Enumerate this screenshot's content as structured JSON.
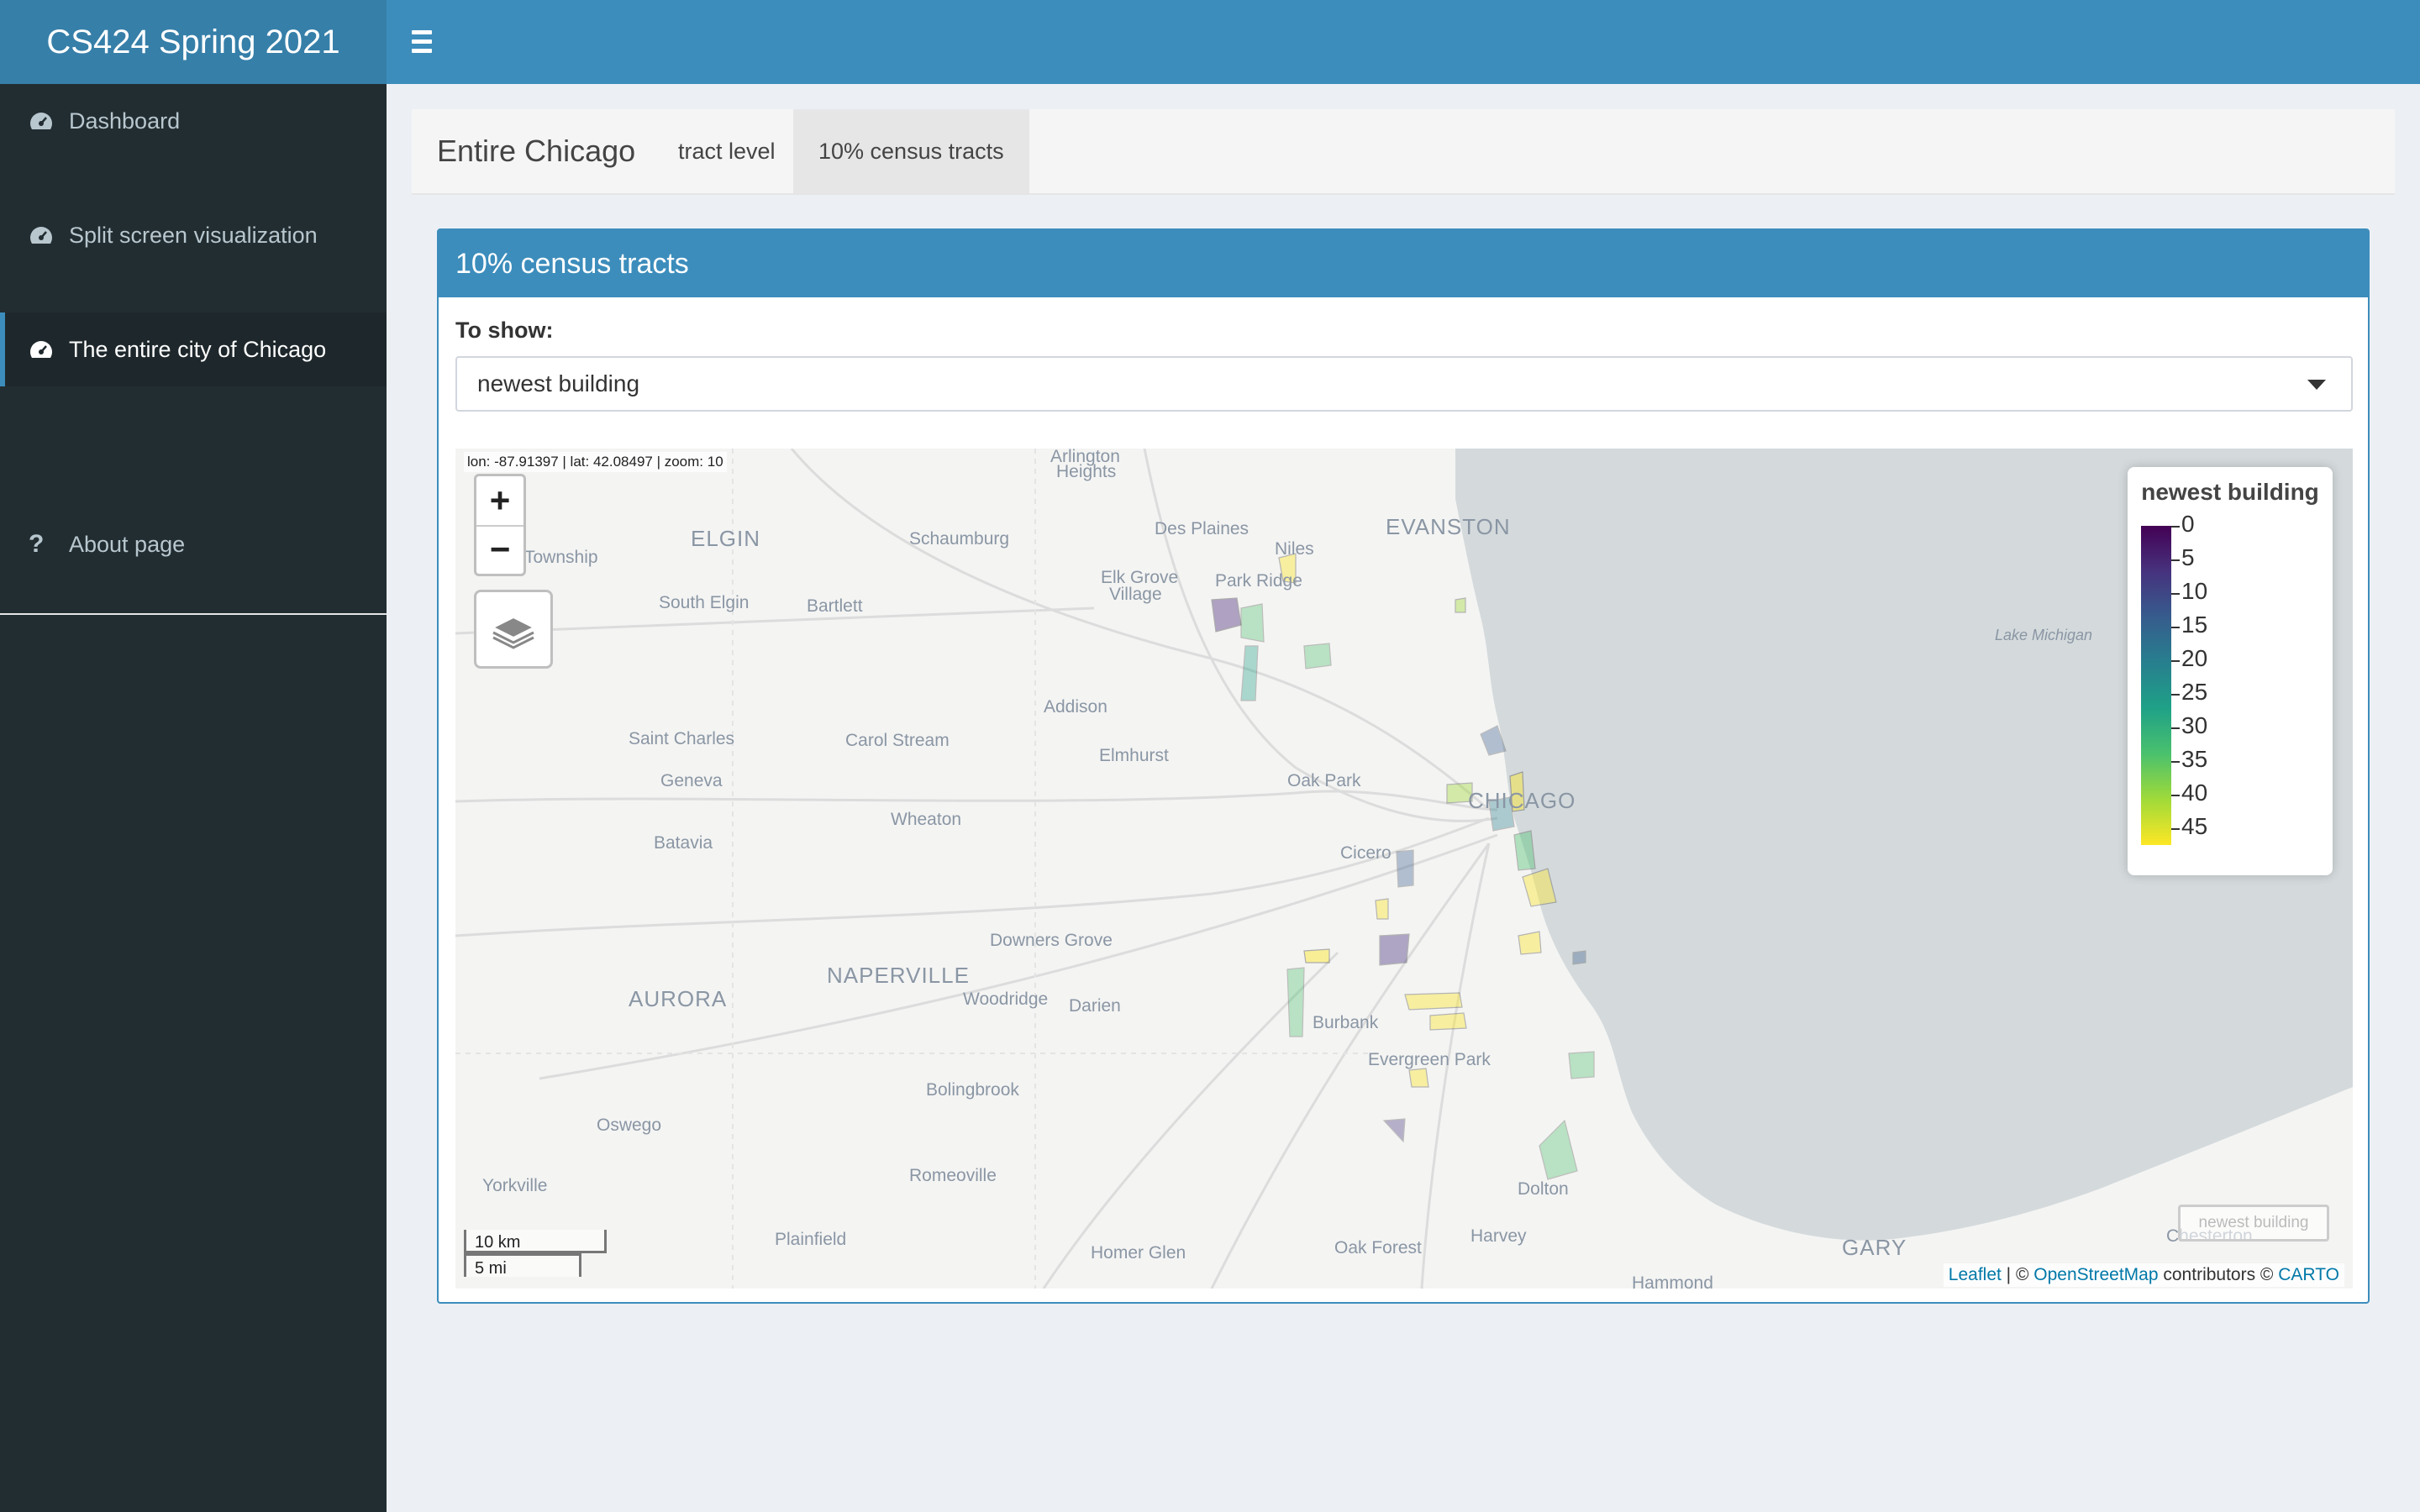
{
  "app": {
    "title": "CS424 Spring 2021"
  },
  "sidebar": {
    "items": [
      {
        "label": "Dashboard",
        "icon": "dashboard-icon"
      },
      {
        "label": "Split screen visualization",
        "icon": "dashboard-icon"
      },
      {
        "label": "The entire city of Chicago",
        "icon": "dashboard-icon",
        "active": true
      },
      {
        "label": "About page",
        "icon": "question-icon"
      }
    ]
  },
  "tabbox": {
    "title": "Entire Chicago",
    "tabs": [
      {
        "label": "tract level"
      },
      {
        "label": "10% census tracts",
        "active": true
      }
    ]
  },
  "panel": {
    "title": "10% census tracts",
    "select_label": "To show:",
    "selected": "newest building"
  },
  "map": {
    "mouse_position": "lon: -87.91397 | lat: 42.08497 | zoom: 10",
    "zoom_in": "+",
    "zoom_out": "−",
    "legend": {
      "title": "newest building",
      "ticks": [
        "0",
        "5",
        "10",
        "15",
        "20",
        "25",
        "30",
        "35",
        "40",
        "45"
      ],
      "palette": [
        "#440154",
        "#46327e",
        "#365c8d",
        "#277f8e",
        "#1fa187",
        "#4ac16d",
        "#a0da39",
        "#fde725"
      ]
    },
    "scale": {
      "metric": "10 km",
      "imperial": "5 mi"
    },
    "minimap_toggle": "newest building",
    "attribution": {
      "leaflet": "Leaflet",
      "sep1": " | © ",
      "osm": "OpenStreetMap",
      "mid": " contributors © ",
      "carto": "CARTO"
    },
    "places": [
      "Arlington",
      "Heights",
      "Des Plaines",
      "Niles",
      "EVANSTON",
      "ELGIN",
      "Schaumburg",
      "Township",
      "Elk Grove",
      "Village",
      "Park Ridge",
      "South Elgin",
      "Bartlett",
      "Lake Michigan",
      "Addison",
      "Saint Charles",
      "Carol Stream",
      "Elmhurst",
      "Geneva",
      "Oak Park",
      "CHICAGO",
      "Wheaton",
      "Batavia",
      "Cicero",
      "Downers Grove",
      "NAPERVILLE",
      "AURORA",
      "Woodridge",
      "Darien",
      "Burbank",
      "Evergreen Park",
      "Bolingbrook",
      "Oswego",
      "Romeoville",
      "Yorkville",
      "Dolton",
      "Plainfield",
      "Homer Glen",
      "Oak Forest",
      "Harvey",
      "GARY",
      "Chesterton",
      "Hammond"
    ],
    "map_colors": {
      "land": "#f4f4f3",
      "water": "#d4dadc"
    }
  }
}
